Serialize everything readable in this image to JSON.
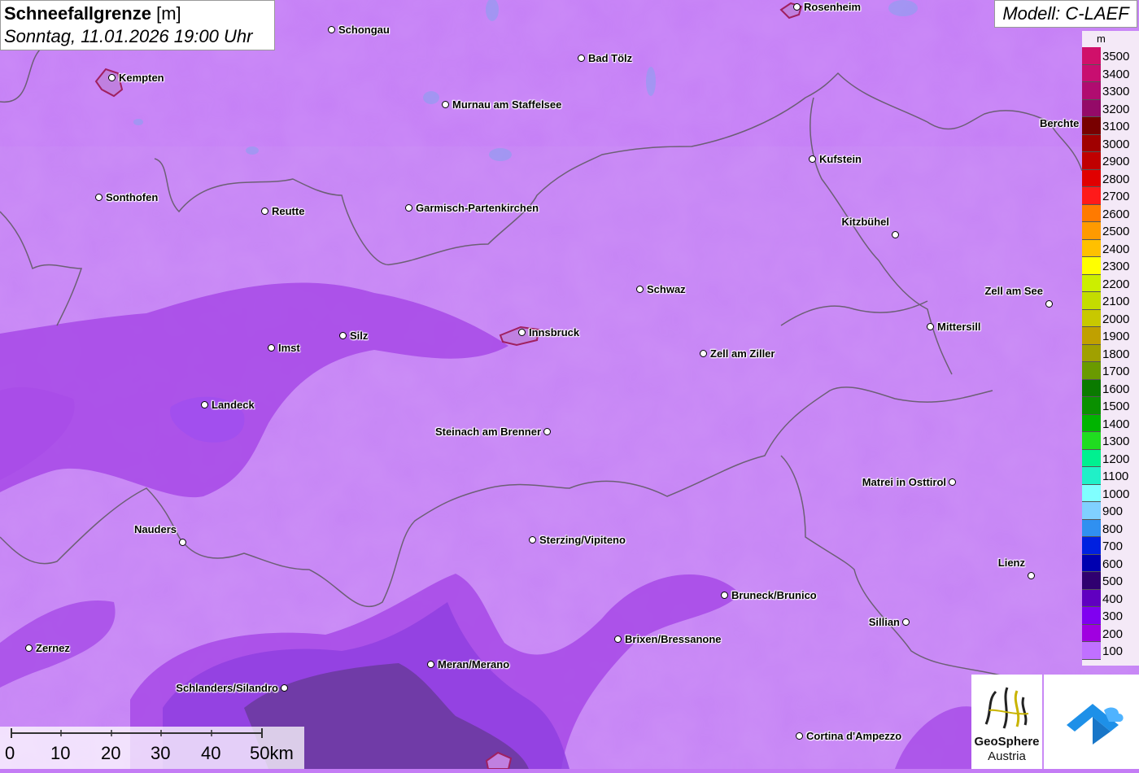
{
  "title": {
    "main": "Schneefallgrenze",
    "unit": "[m]",
    "datetime": "Sonntag, 11.01.2026 19:00 Uhr"
  },
  "model": "Modell: C-LAEF",
  "legend": {
    "unit": "m",
    "entries": [
      {
        "label": "3500",
        "color": "#d0106a"
      },
      {
        "label": "3400",
        "color": "#c80e70"
      },
      {
        "label": "3300",
        "color": "#b00c70"
      },
      {
        "label": "3200",
        "color": "#940a68"
      },
      {
        "label": "3100",
        "color": "#780000"
      },
      {
        "label": "3000",
        "color": "#a00000"
      },
      {
        "label": "2900",
        "color": "#c00000"
      },
      {
        "label": "2800",
        "color": "#e00000"
      },
      {
        "label": "2700",
        "color": "#ff1a1a"
      },
      {
        "label": "2600",
        "color": "#ff7a00"
      },
      {
        "label": "2500",
        "color": "#ff9a00"
      },
      {
        "label": "2400",
        "color": "#ffc000"
      },
      {
        "label": "2300",
        "color": "#ffff00"
      },
      {
        "label": "2200",
        "color": "#ccee00"
      },
      {
        "label": "2100",
        "color": "#c4dc00"
      },
      {
        "label": "2000",
        "color": "#c8c800"
      },
      {
        "label": "1900",
        "color": "#c0a000"
      },
      {
        "label": "1800",
        "color": "#a0a000"
      },
      {
        "label": "1700",
        "color": "#6a9a00"
      },
      {
        "label": "1600",
        "color": "#0a7a00"
      },
      {
        "label": "1500",
        "color": "#0a9000"
      },
      {
        "label": "1400",
        "color": "#00b400"
      },
      {
        "label": "1300",
        "color": "#20dc20"
      },
      {
        "label": "1200",
        "color": "#00f090"
      },
      {
        "label": "1100",
        "color": "#20f0c8"
      },
      {
        "label": "1000",
        "color": "#80ffff"
      },
      {
        "label": "900",
        "color": "#80d0ff"
      },
      {
        "label": "800",
        "color": "#3090f0"
      },
      {
        "label": "700",
        "color": "#0020e0"
      },
      {
        "label": "600",
        "color": "#0000b0"
      },
      {
        "label": "500",
        "color": "#300070"
      },
      {
        "label": "400",
        "color": "#6000c0"
      },
      {
        "label": "300",
        "color": "#8000f0"
      },
      {
        "label": "200",
        "color": "#a000e0"
      },
      {
        "label": "100",
        "color": "#c070ff"
      }
    ]
  },
  "cities": [
    {
      "name": "Rosenheim"
    },
    {
      "name": "Schongau"
    },
    {
      "name": "Kempten"
    },
    {
      "name": "Bad Tölz"
    },
    {
      "name": "Murnau am Staffelsee"
    },
    {
      "name": "Kufstein"
    },
    {
      "name": "Sonthofen"
    },
    {
      "name": "Reutte"
    },
    {
      "name": "Garmisch-Partenkirchen"
    },
    {
      "name": "Kitzbühel"
    },
    {
      "name": "Schwaz"
    },
    {
      "name": "Zell am See"
    },
    {
      "name": "Mittersill"
    },
    {
      "name": "Silz"
    },
    {
      "name": "Innsbruck"
    },
    {
      "name": "Imst"
    },
    {
      "name": "Zell am Ziller"
    },
    {
      "name": "Landeck"
    },
    {
      "name": "Steinach am Brenner"
    },
    {
      "name": "Matrei in Osttirol"
    },
    {
      "name": "Nauders"
    },
    {
      "name": "Sterzing/Vipiteno"
    },
    {
      "name": "Lienz"
    },
    {
      "name": "Bruneck/Brunico"
    },
    {
      "name": "Sillian"
    },
    {
      "name": "Zernez"
    },
    {
      "name": "Brixen/Bressanone"
    },
    {
      "name": "Meran/Merano"
    },
    {
      "name": "Schlanders/Silandro"
    },
    {
      "name": "Cortina d'Ampezzo"
    },
    {
      "name": "Berchte"
    }
  ],
  "scale": {
    "ticks": [
      "0",
      "10",
      "20",
      "30",
      "40",
      "50km"
    ]
  },
  "logo": {
    "line1": "GeoSphere",
    "line2": "Austria"
  }
}
